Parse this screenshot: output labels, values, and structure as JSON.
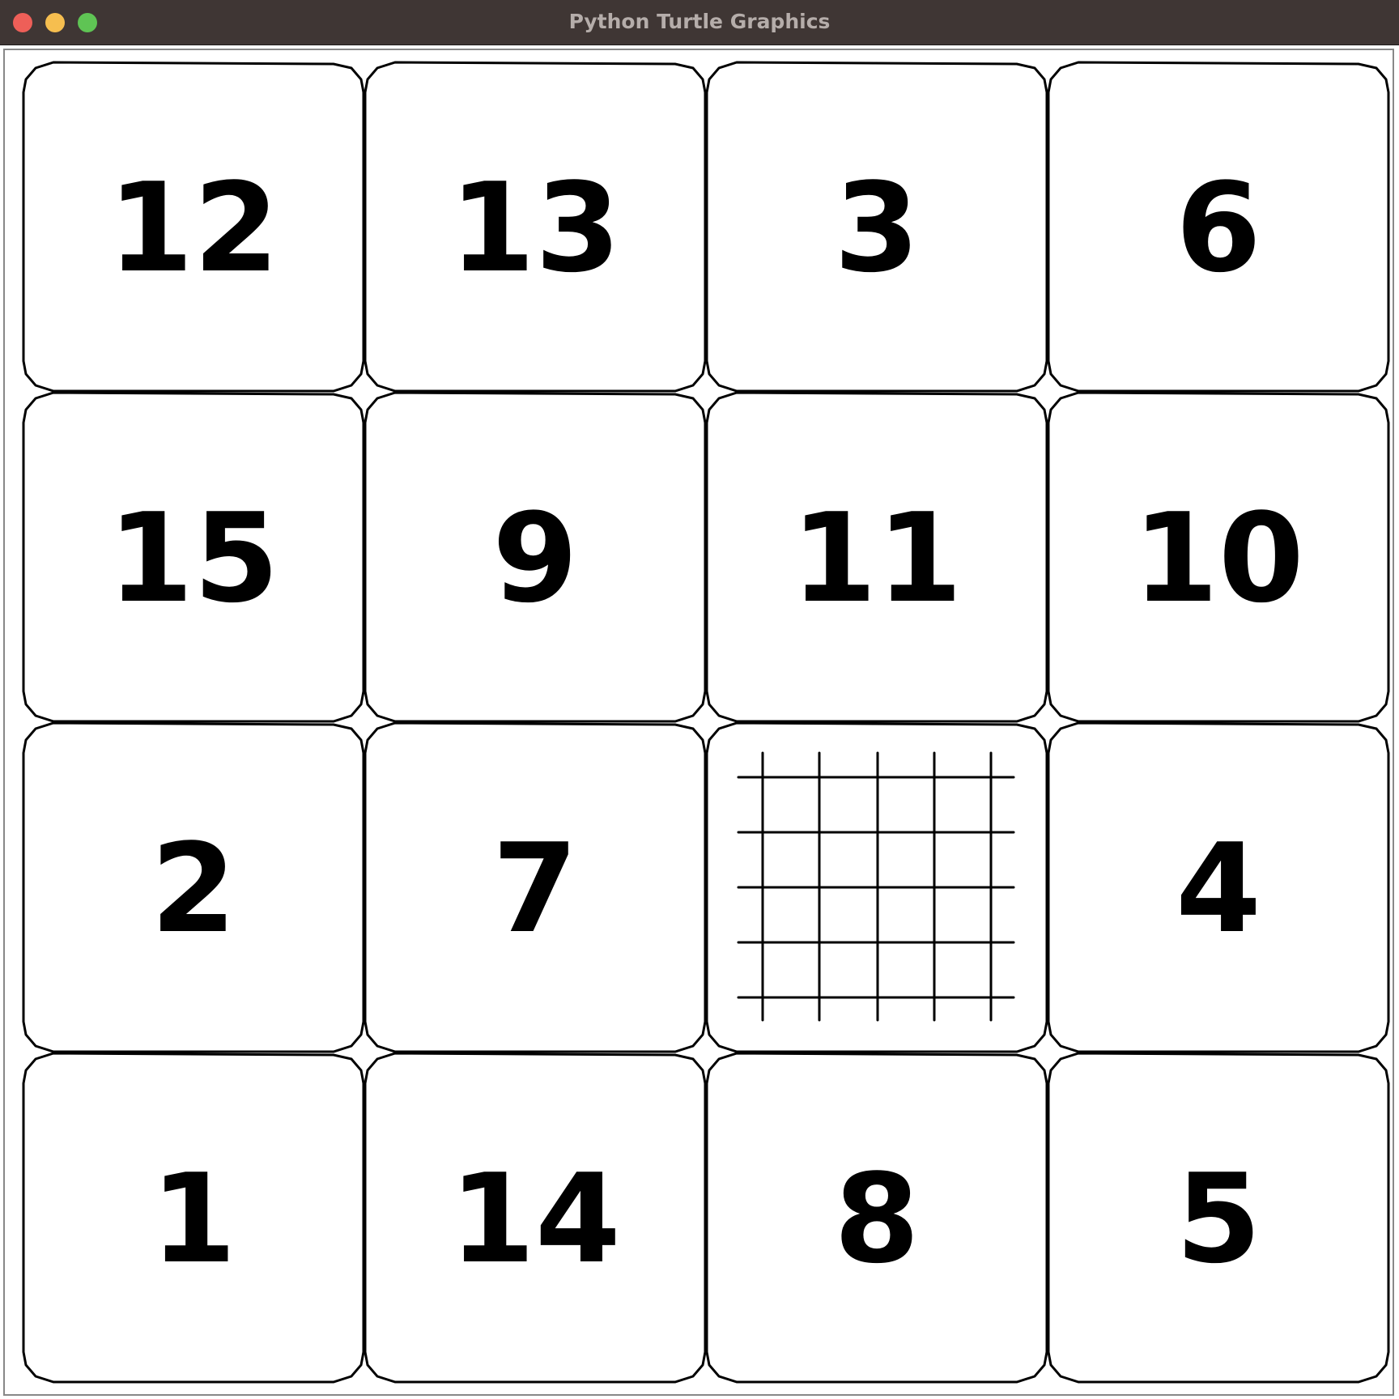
{
  "window": {
    "title": "Python Turtle Graphics"
  },
  "colors": {
    "titlebar": "#3f3634",
    "close": "#ee5f58",
    "minimize": "#f6be4f",
    "maximize": "#5fc454",
    "tile_outline": "#000000",
    "background": "#ffffff"
  },
  "puzzle": {
    "rows": 4,
    "cols": 4,
    "tiles": [
      [
        "12",
        "13",
        "3",
        "6"
      ],
      [
        "15",
        "9",
        "11",
        "10"
      ],
      [
        "2",
        "7",
        "",
        "4"
      ],
      [
        "1",
        "14",
        "8",
        "5"
      ]
    ],
    "empty_tile_icon": "grid-icon"
  }
}
